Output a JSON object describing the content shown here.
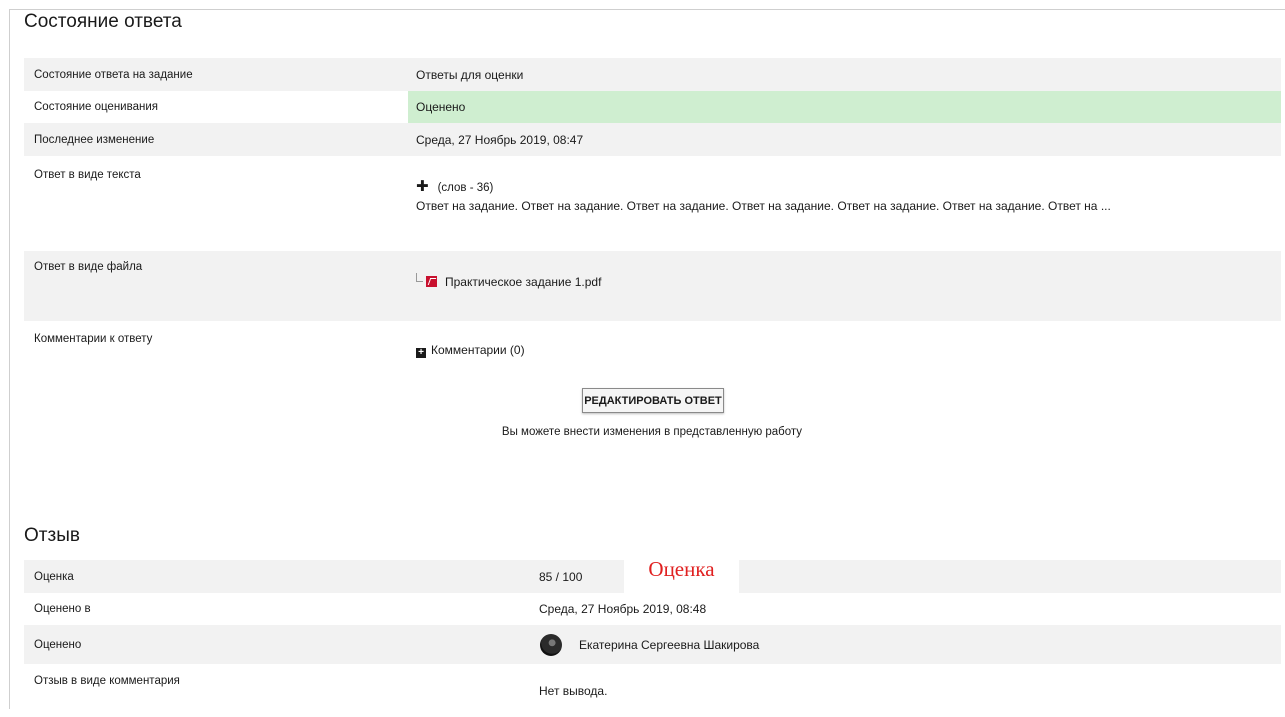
{
  "submission": {
    "title": "Состояние ответа",
    "rows": [
      {
        "label": "Состояние ответа на задание",
        "value": "Ответы для оценки"
      },
      {
        "label": "Состояние оценивания",
        "value": "Оценено"
      },
      {
        "label": "Последнее изменение",
        "value": "Среда, 27 Ноябрь 2019, 08:47"
      }
    ],
    "online_text": {
      "label": "Ответ в виде текста",
      "words": "(слов - 36)",
      "preview": "Ответ на задание. Ответ на задание. Ответ на задание. Ответ на задание. Ответ на задание. Ответ на задание. Ответ на ..."
    },
    "file": {
      "label": "Ответ в виде файла",
      "name": "Практическое задание 1.pdf"
    },
    "comments": {
      "label": "Комментарии к ответу",
      "link": "Комментарии (0)"
    },
    "edit_button": "РЕДАКТИРОВАТЬ ОТВЕТ",
    "edit_note": "Вы можете внести изменения в представленную работу"
  },
  "feedback": {
    "title": "Отзыв",
    "grade_label": "Оценка",
    "grade_value": "85 / 100",
    "annotation": "Оценка",
    "graded_on_label": "Оценено в",
    "graded_on_value": "Среда, 27 Ноябрь 2019, 08:48",
    "graded_by_label": "Оценено",
    "graded_by_value": "Екатерина Сергеевна Шакирова",
    "comment_label": "Отзыв в виде комментария",
    "comment_value": "Нет вывода."
  },
  "colors": {
    "graded_bg": "#cfeed0",
    "stripe": "#f2f2f2",
    "annotation": "#e02020"
  }
}
